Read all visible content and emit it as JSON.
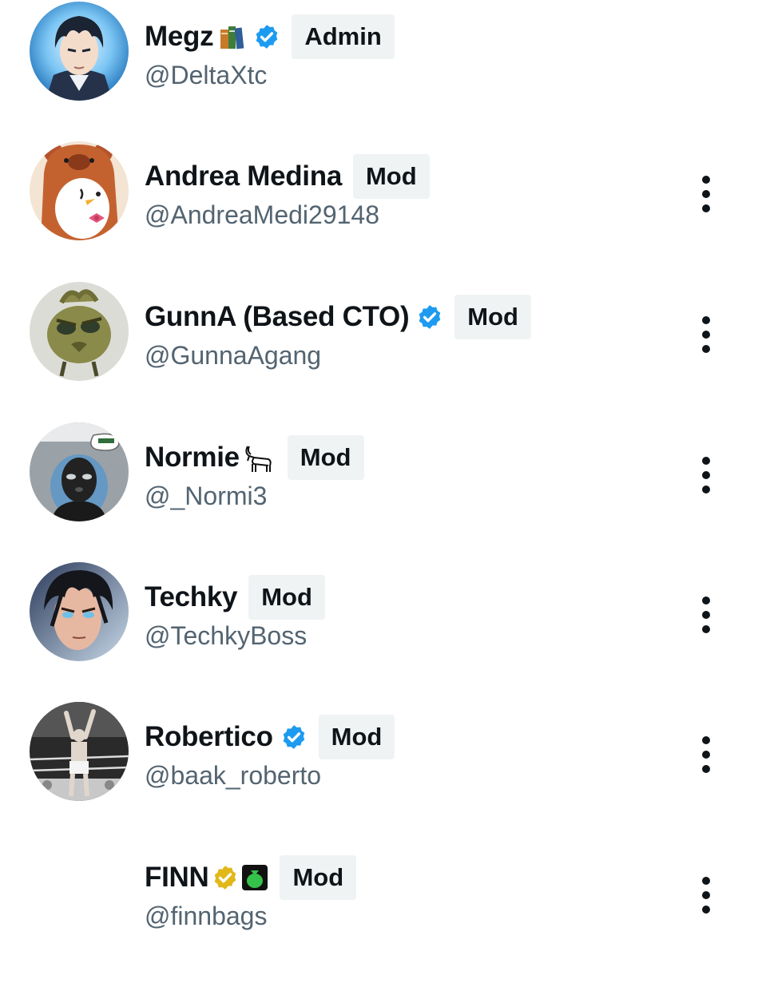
{
  "members": [
    {
      "name": "Megz",
      "handle": "@DeltaXtc",
      "badge": "Admin",
      "verified": "blue",
      "emoji": "books-icon",
      "avatar": "anime-blue-hair",
      "has_more": false
    },
    {
      "name": "Andrea Medina",
      "handle": "@AndreaMedi29148",
      "badge": "Mod",
      "verified": null,
      "emoji": null,
      "avatar": "penguin-bear-hood",
      "has_more": true
    },
    {
      "name": "GunnA (Based CTO)",
      "handle": "@GunnaAgang",
      "badge": "Mod",
      "verified": "blue",
      "emoji": null,
      "avatar": "green-bird-creature",
      "has_more": true
    },
    {
      "name": "Normie",
      "handle": "@_Normi3",
      "badge": "Mod",
      "verified": null,
      "emoji": "goat-icon",
      "avatar": "balaclava-figure",
      "has_more": true
    },
    {
      "name": "Techky",
      "handle": "@TechkyBoss",
      "badge": "Mod",
      "verified": null,
      "emoji": null,
      "avatar": "anime-fighter",
      "has_more": true
    },
    {
      "name": "Robertico",
      "handle": "@baak_roberto",
      "badge": "Mod",
      "verified": "blue",
      "emoji": null,
      "avatar": "boxer-ring",
      "has_more": true
    },
    {
      "name": "FINN",
      "handle": "@finnbags",
      "badge": "Mod",
      "verified": "gold",
      "emoji": "money-bag-icon",
      "avatar": null,
      "has_more": true
    }
  ],
  "colors": {
    "verified_blue": "#1d9bf0",
    "verified_gold": "#e2b719",
    "badge_bg": "#eff3f4",
    "handle_gray": "#536471",
    "text": "#0f1419"
  }
}
